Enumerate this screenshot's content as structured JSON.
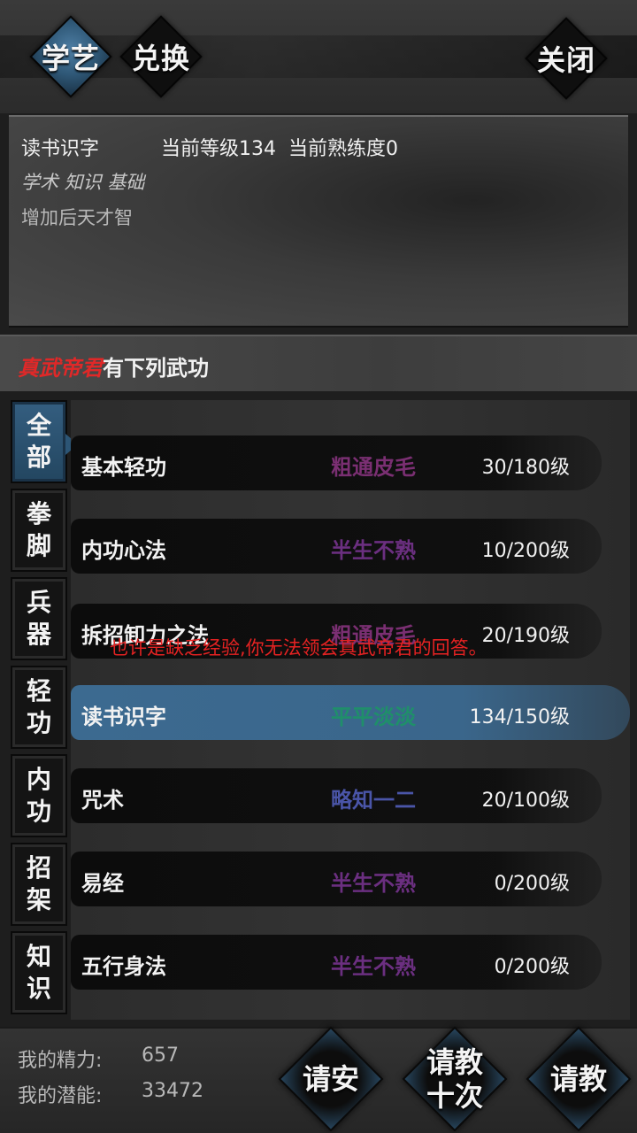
{
  "topbar": {
    "tabs": [
      {
        "label": "学艺",
        "active": true
      },
      {
        "label": "兑换",
        "active": false
      }
    ],
    "close_label": "关闭"
  },
  "info": {
    "skill_name": "读书识字",
    "level_text": "当前等级134",
    "proficiency_text": "当前熟练度0",
    "tags": "学术 知识 基础",
    "description": "增加后天才智"
  },
  "master_header": {
    "master_name": "真武帝君",
    "suffix": "有下列武功"
  },
  "categories": [
    {
      "chars": [
        "全",
        "部"
      ],
      "active": true
    },
    {
      "chars": [
        "拳",
        "脚"
      ],
      "active": false
    },
    {
      "chars": [
        "兵",
        "器"
      ],
      "active": false
    },
    {
      "chars": [
        "轻",
        "功"
      ],
      "active": false
    },
    {
      "chars": [
        "内",
        "功"
      ],
      "active": false
    },
    {
      "chars": [
        "招",
        "架"
      ],
      "active": false
    },
    {
      "chars": [
        "知",
        "识"
      ],
      "active": false
    }
  ],
  "skills": [
    {
      "name": "基本轻功",
      "grade": "粗通皮毛",
      "grade_color": "#7a2f72",
      "level": "30/180级",
      "selected": false
    },
    {
      "name": "内功心法",
      "grade": "半生不熟",
      "grade_color": "#6b2f80",
      "level": "10/200级",
      "selected": false
    },
    {
      "name": "拆招卸力之法",
      "grade": "粗通皮毛",
      "grade_color": "#7a2f72",
      "level": "20/190级",
      "selected": false
    },
    {
      "name": "读书识字",
      "grade": "平平淡淡",
      "grade_color": "#1f8f6a",
      "level": "134/150级",
      "selected": true
    },
    {
      "name": "咒术",
      "grade": "略知一二",
      "grade_color": "#4a55a8",
      "level": "20/100级",
      "selected": false
    },
    {
      "name": "易经",
      "grade": "半生不熟",
      "grade_color": "#6b2f80",
      "level": "0/200级",
      "selected": false
    },
    {
      "name": "五行身法",
      "grade": "半生不熟",
      "grade_color": "#6b2f80",
      "level": "0/200级",
      "selected": false
    }
  ],
  "toast": "也许是缺乏经验,你无法领会真武帝君的回答。",
  "stats": {
    "energy_label": "我的精力:",
    "energy_value": "657",
    "potential_label": "我的潜能:",
    "potential_value": "33472"
  },
  "actions": {
    "greet": "请安",
    "ask_ten_line1": "请教",
    "ask_ten_line2": "十次",
    "ask": "请教"
  }
}
